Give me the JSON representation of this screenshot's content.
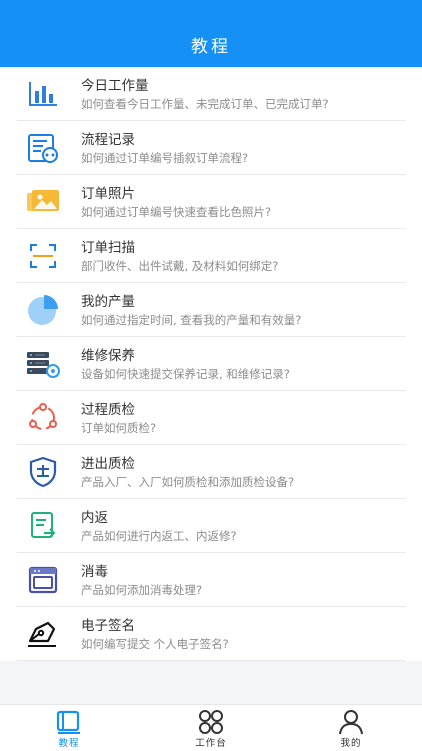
{
  "header": {
    "title": "教程"
  },
  "items": [
    {
      "title": "今日工作量",
      "desc": "如何查看今日工作量、未完成订单、已完成订单?",
      "icon": "bar-chart-icon"
    },
    {
      "title": "流程记录",
      "desc": "如何通过订单编号插叙订单流程?",
      "icon": "process-record-icon"
    },
    {
      "title": "订单照片",
      "desc": "如何通过订单编号快速查看比色照片?",
      "icon": "photo-icon"
    },
    {
      "title": "订单扫描",
      "desc": "部门收件、出件试戴, 及材料如何绑定?",
      "icon": "scan-icon"
    },
    {
      "title": "我的产量",
      "desc": "如何通过指定时间, 查看我的产量和有效量?",
      "icon": "pie-chart-icon"
    },
    {
      "title": "维修保养",
      "desc": "设备如何快速提交保养记录, 和维修记录?",
      "icon": "server-maintenance-icon"
    },
    {
      "title": "过程质检",
      "desc": "订单如何质检?",
      "icon": "cycle-icon"
    },
    {
      "title": "进出质检",
      "desc": "产品入厂、入厂如何质检和添加质检设备?",
      "icon": "inspection-shield-icon"
    },
    {
      "title": "内返",
      "desc": "产品如何进行内返工、内返修?",
      "icon": "return-document-icon"
    },
    {
      "title": "消毒",
      "desc": "产品如何添加消毒处理?",
      "icon": "disinfect-oven-icon"
    },
    {
      "title": "电子签名",
      "desc": "如何编写提交 个人电子签名?",
      "icon": "pen-signature-icon"
    }
  ],
  "tabbar": {
    "tabs": [
      {
        "label": "教程",
        "icon": "book-icon",
        "active": true
      },
      {
        "label": "工作台",
        "icon": "grid-workbench-icon",
        "active": false
      },
      {
        "label": "我的",
        "icon": "user-icon",
        "active": false
      }
    ]
  },
  "colors": {
    "header": "#1591f5",
    "active_tab": "#1591f5",
    "inactive_tab": "#333333"
  }
}
